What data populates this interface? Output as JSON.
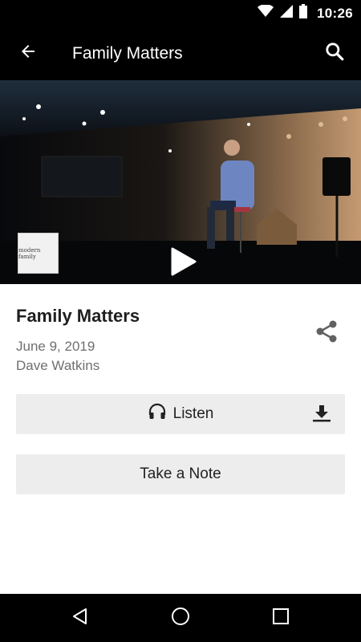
{
  "status_bar": {
    "time": "10:26"
  },
  "app_bar": {
    "title": "Family Matters"
  },
  "media": {
    "series_thumbnail_text": "modern family"
  },
  "sermon": {
    "title": "Family Matters",
    "date": "June 9, 2019",
    "speaker": "Dave Watkins"
  },
  "actions": {
    "listen_label": "Listen",
    "note_label": "Take a Note"
  },
  "icons": {
    "status": [
      "wifi-icon",
      "cell-signal-icon",
      "battery-icon"
    ],
    "app_bar": [
      "back-arrow-icon",
      "search-icon"
    ],
    "content": [
      "play-icon",
      "share-icon",
      "headphones-icon",
      "download-icon"
    ],
    "nav": [
      "back-triangle-icon",
      "home-circle-icon",
      "recents-square-icon"
    ]
  },
  "colors": {
    "bars": "#000000",
    "button_bg": "#ededed",
    "secondary_text": "#6f6f6f"
  }
}
